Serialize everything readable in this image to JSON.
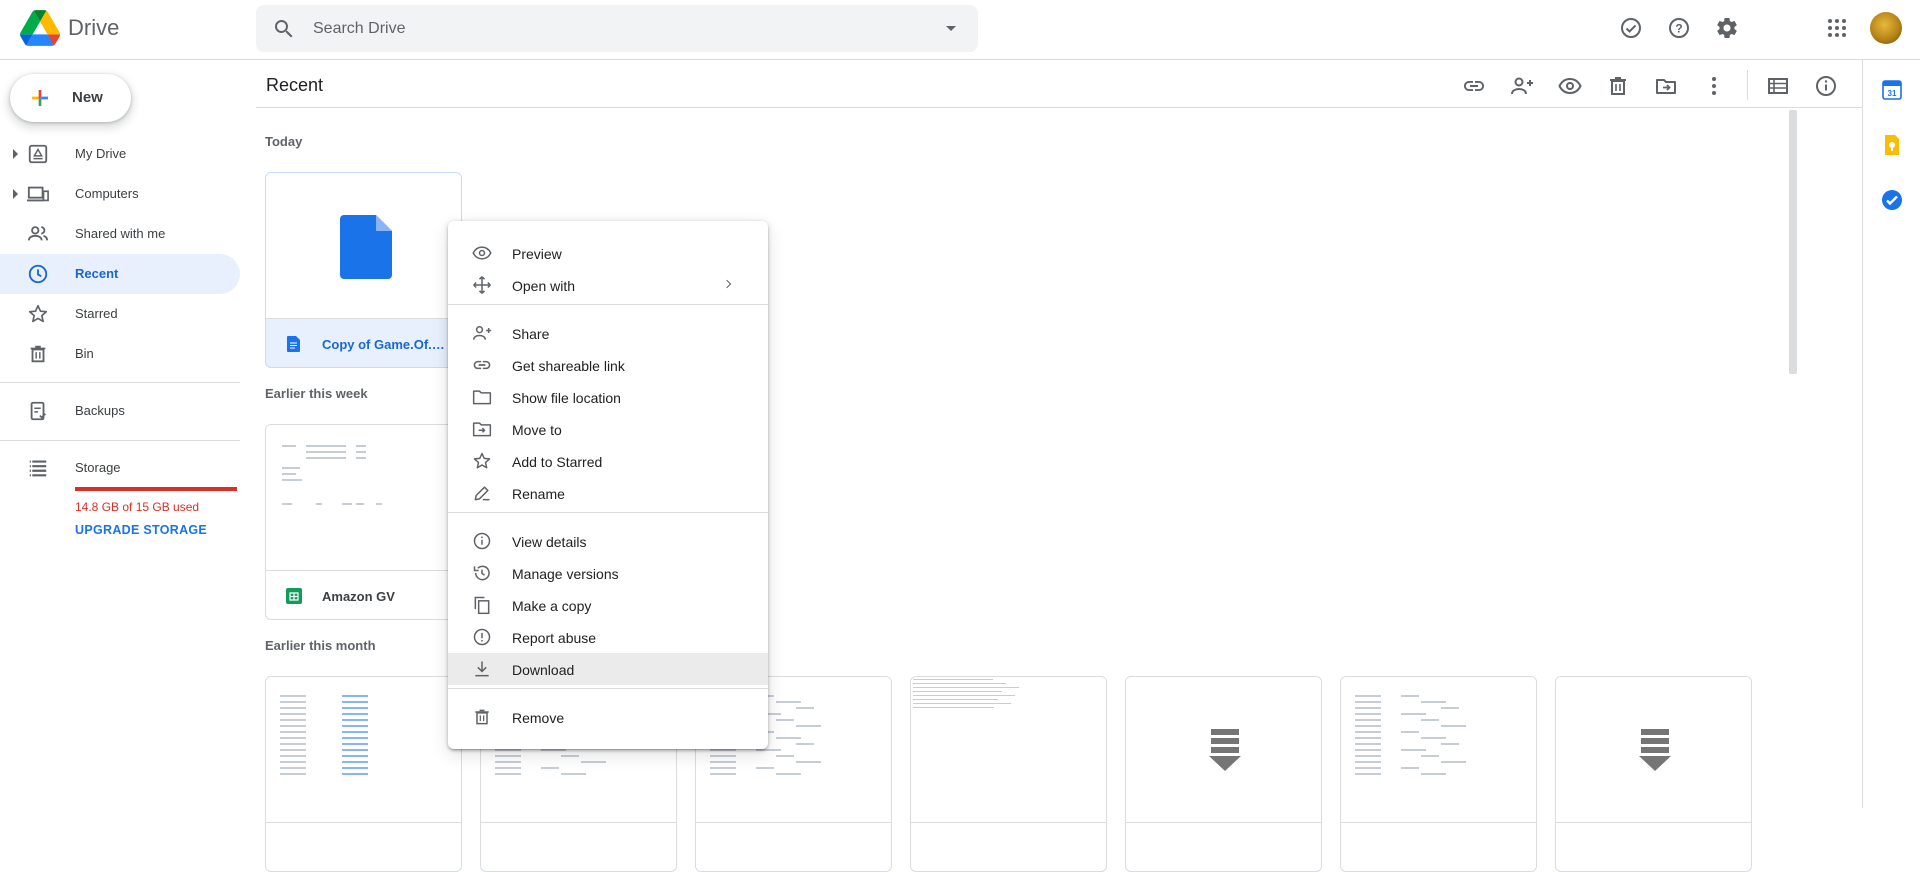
{
  "app": {
    "name": "Drive"
  },
  "search": {
    "placeholder": "Search Drive"
  },
  "header_icons": [
    "support-check-icon",
    "help-icon",
    "settings-icon",
    "apps-grid-icon",
    "account-avatar"
  ],
  "new_button": {
    "label": "New"
  },
  "sidebar": {
    "items": [
      {
        "label": "My Drive",
        "icon": "my-drive-icon",
        "expandable": true,
        "active": false
      },
      {
        "label": "Computers",
        "icon": "computers-icon",
        "expandable": true,
        "active": false
      },
      {
        "label": "Shared with me",
        "icon": "shared-icon",
        "expandable": false,
        "active": false
      },
      {
        "label": "Recent",
        "icon": "clock-icon",
        "expandable": false,
        "active": true
      },
      {
        "label": "Starred",
        "icon": "star-icon",
        "expandable": false,
        "active": false
      },
      {
        "label": "Bin",
        "icon": "bin-icon",
        "expandable": false,
        "active": false
      },
      {
        "label": "Backups",
        "icon": "backups-icon",
        "expandable": false,
        "active": false
      },
      {
        "label": "Storage",
        "icon": "storage-icon",
        "expandable": false,
        "active": false
      }
    ],
    "storage": {
      "used_text": "14.8 GB of 15 GB used",
      "used_fraction": 0.987,
      "upgrade_label": "UPGRADE STORAGE",
      "bar_color": "#d93025"
    }
  },
  "main": {
    "title": "Recent",
    "toolbar_icons": [
      "link-icon",
      "share-icon",
      "preview-icon",
      "delete-icon",
      "move-icon",
      "more-icon",
      "list-view-icon",
      "info-icon"
    ],
    "sections": [
      {
        "label": "Today",
        "files": [
          {
            "name": "Copy of Game.Of.Th...",
            "type": "doc",
            "selected": true
          }
        ]
      },
      {
        "label": "Earlier this week",
        "files": [
          {
            "name": "Amazon GV",
            "type": "sheet",
            "selected": false
          }
        ]
      },
      {
        "label": "Earlier this month",
        "files": [
          {
            "name": "",
            "type": "sheet"
          },
          {
            "name": "",
            "type": "sheet"
          },
          {
            "name": "",
            "type": "sheet"
          },
          {
            "name": "",
            "type": "text"
          },
          {
            "name": "",
            "type": "download"
          },
          {
            "name": "",
            "type": "sheet"
          },
          {
            "name": "",
            "type": "download"
          }
        ]
      }
    ]
  },
  "context_menu": {
    "groups": [
      [
        {
          "label": "Preview",
          "icon": "eye-icon"
        },
        {
          "label": "Open with",
          "icon": "open-with-icon",
          "submenu": true
        }
      ],
      [
        {
          "label": "Share",
          "icon": "share-icon"
        },
        {
          "label": "Get shareable link",
          "icon": "link-icon"
        },
        {
          "label": "Show file location",
          "icon": "folder-icon"
        },
        {
          "label": "Move to",
          "icon": "move-to-icon"
        },
        {
          "label": "Add to Starred",
          "icon": "star-icon"
        },
        {
          "label": "Rename",
          "icon": "rename-icon"
        }
      ],
      [
        {
          "label": "View details",
          "icon": "info-icon"
        },
        {
          "label": "Manage versions",
          "icon": "history-icon"
        },
        {
          "label": "Make a copy",
          "icon": "copy-icon"
        },
        {
          "label": "Report abuse",
          "icon": "report-icon"
        },
        {
          "label": "Download",
          "icon": "download-icon",
          "hovered": true
        }
      ],
      [
        {
          "label": "Remove",
          "icon": "bin-icon"
        }
      ]
    ]
  },
  "side_apps": [
    "calendar-icon",
    "keep-icon",
    "tasks-icon"
  ],
  "colors": {
    "accent": "#1a73e8",
    "active_bg": "#e8f0fe",
    "warning": "#d93025"
  }
}
